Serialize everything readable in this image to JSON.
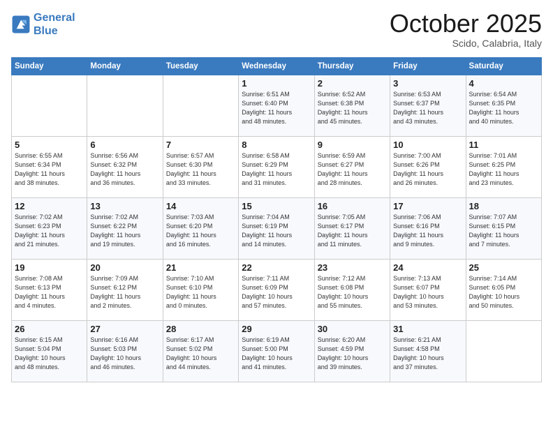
{
  "header": {
    "logo_line1": "General",
    "logo_line2": "Blue",
    "month": "October 2025",
    "location": "Scido, Calabria, Italy"
  },
  "weekdays": [
    "Sunday",
    "Monday",
    "Tuesday",
    "Wednesday",
    "Thursday",
    "Friday",
    "Saturday"
  ],
  "weeks": [
    [
      {
        "day": "",
        "info": ""
      },
      {
        "day": "",
        "info": ""
      },
      {
        "day": "",
        "info": ""
      },
      {
        "day": "1",
        "info": "Sunrise: 6:51 AM\nSunset: 6:40 PM\nDaylight: 11 hours\nand 48 minutes."
      },
      {
        "day": "2",
        "info": "Sunrise: 6:52 AM\nSunset: 6:38 PM\nDaylight: 11 hours\nand 45 minutes."
      },
      {
        "day": "3",
        "info": "Sunrise: 6:53 AM\nSunset: 6:37 PM\nDaylight: 11 hours\nand 43 minutes."
      },
      {
        "day": "4",
        "info": "Sunrise: 6:54 AM\nSunset: 6:35 PM\nDaylight: 11 hours\nand 40 minutes."
      }
    ],
    [
      {
        "day": "5",
        "info": "Sunrise: 6:55 AM\nSunset: 6:34 PM\nDaylight: 11 hours\nand 38 minutes."
      },
      {
        "day": "6",
        "info": "Sunrise: 6:56 AM\nSunset: 6:32 PM\nDaylight: 11 hours\nand 36 minutes."
      },
      {
        "day": "7",
        "info": "Sunrise: 6:57 AM\nSunset: 6:30 PM\nDaylight: 11 hours\nand 33 minutes."
      },
      {
        "day": "8",
        "info": "Sunrise: 6:58 AM\nSunset: 6:29 PM\nDaylight: 11 hours\nand 31 minutes."
      },
      {
        "day": "9",
        "info": "Sunrise: 6:59 AM\nSunset: 6:27 PM\nDaylight: 11 hours\nand 28 minutes."
      },
      {
        "day": "10",
        "info": "Sunrise: 7:00 AM\nSunset: 6:26 PM\nDaylight: 11 hours\nand 26 minutes."
      },
      {
        "day": "11",
        "info": "Sunrise: 7:01 AM\nSunset: 6:25 PM\nDaylight: 11 hours\nand 23 minutes."
      }
    ],
    [
      {
        "day": "12",
        "info": "Sunrise: 7:02 AM\nSunset: 6:23 PM\nDaylight: 11 hours\nand 21 minutes."
      },
      {
        "day": "13",
        "info": "Sunrise: 7:02 AM\nSunset: 6:22 PM\nDaylight: 11 hours\nand 19 minutes."
      },
      {
        "day": "14",
        "info": "Sunrise: 7:03 AM\nSunset: 6:20 PM\nDaylight: 11 hours\nand 16 minutes."
      },
      {
        "day": "15",
        "info": "Sunrise: 7:04 AM\nSunset: 6:19 PM\nDaylight: 11 hours\nand 14 minutes."
      },
      {
        "day": "16",
        "info": "Sunrise: 7:05 AM\nSunset: 6:17 PM\nDaylight: 11 hours\nand 11 minutes."
      },
      {
        "day": "17",
        "info": "Sunrise: 7:06 AM\nSunset: 6:16 PM\nDaylight: 11 hours\nand 9 minutes."
      },
      {
        "day": "18",
        "info": "Sunrise: 7:07 AM\nSunset: 6:15 PM\nDaylight: 11 hours\nand 7 minutes."
      }
    ],
    [
      {
        "day": "19",
        "info": "Sunrise: 7:08 AM\nSunset: 6:13 PM\nDaylight: 11 hours\nand 4 minutes."
      },
      {
        "day": "20",
        "info": "Sunrise: 7:09 AM\nSunset: 6:12 PM\nDaylight: 11 hours\nand 2 minutes."
      },
      {
        "day": "21",
        "info": "Sunrise: 7:10 AM\nSunset: 6:10 PM\nDaylight: 11 hours\nand 0 minutes."
      },
      {
        "day": "22",
        "info": "Sunrise: 7:11 AM\nSunset: 6:09 PM\nDaylight: 10 hours\nand 57 minutes."
      },
      {
        "day": "23",
        "info": "Sunrise: 7:12 AM\nSunset: 6:08 PM\nDaylight: 10 hours\nand 55 minutes."
      },
      {
        "day": "24",
        "info": "Sunrise: 7:13 AM\nSunset: 6:07 PM\nDaylight: 10 hours\nand 53 minutes."
      },
      {
        "day": "25",
        "info": "Sunrise: 7:14 AM\nSunset: 6:05 PM\nDaylight: 10 hours\nand 50 minutes."
      }
    ],
    [
      {
        "day": "26",
        "info": "Sunrise: 6:15 AM\nSunset: 5:04 PM\nDaylight: 10 hours\nand 48 minutes."
      },
      {
        "day": "27",
        "info": "Sunrise: 6:16 AM\nSunset: 5:03 PM\nDaylight: 10 hours\nand 46 minutes."
      },
      {
        "day": "28",
        "info": "Sunrise: 6:17 AM\nSunset: 5:02 PM\nDaylight: 10 hours\nand 44 minutes."
      },
      {
        "day": "29",
        "info": "Sunrise: 6:19 AM\nSunset: 5:00 PM\nDaylight: 10 hours\nand 41 minutes."
      },
      {
        "day": "30",
        "info": "Sunrise: 6:20 AM\nSunset: 4:59 PM\nDaylight: 10 hours\nand 39 minutes."
      },
      {
        "day": "31",
        "info": "Sunrise: 6:21 AM\nSunset: 4:58 PM\nDaylight: 10 hours\nand 37 minutes."
      },
      {
        "day": "",
        "info": ""
      }
    ]
  ]
}
